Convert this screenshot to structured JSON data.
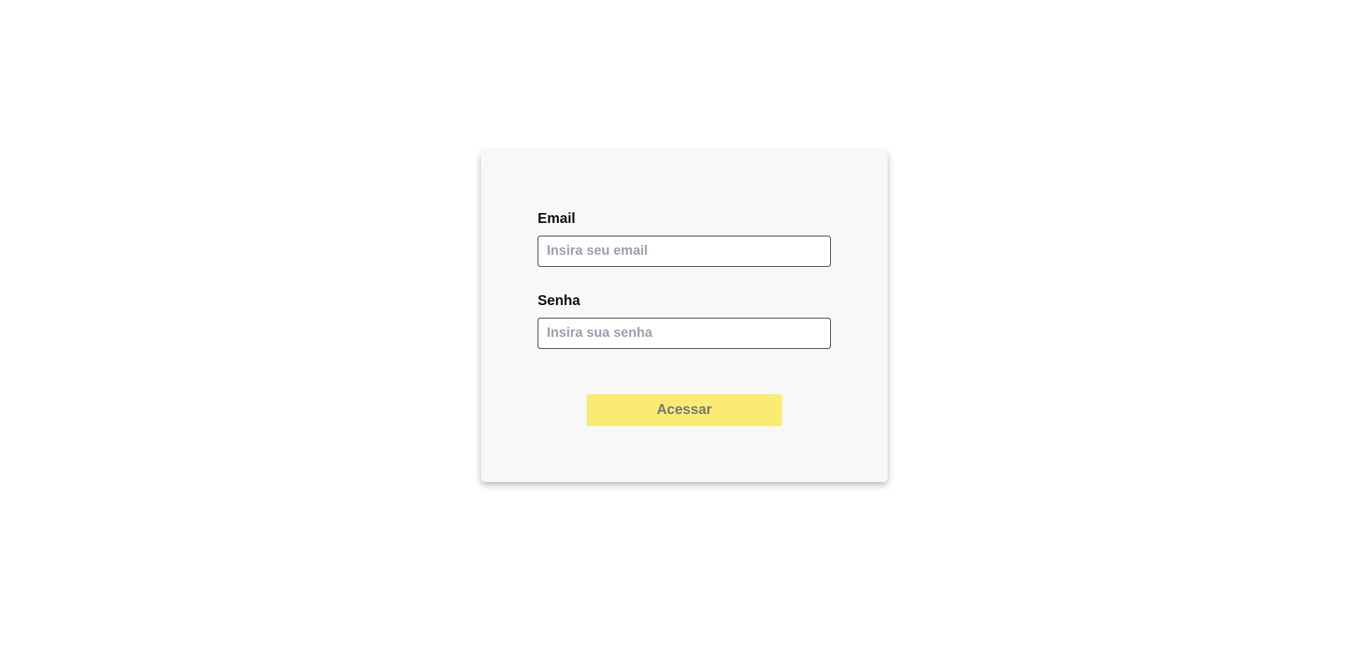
{
  "login_form": {
    "email": {
      "label": "Email",
      "placeholder": "Insira seu email",
      "value": ""
    },
    "password": {
      "label": "Senha",
      "placeholder": "Insira sua senha",
      "value": ""
    },
    "submit_label": "Acessar"
  },
  "colors": {
    "page_background": "#ffffff",
    "card_background": "#f8f8f8",
    "button_background": "#faeb73",
    "button_text": "#777777",
    "placeholder_text": "#9aa0ad"
  }
}
